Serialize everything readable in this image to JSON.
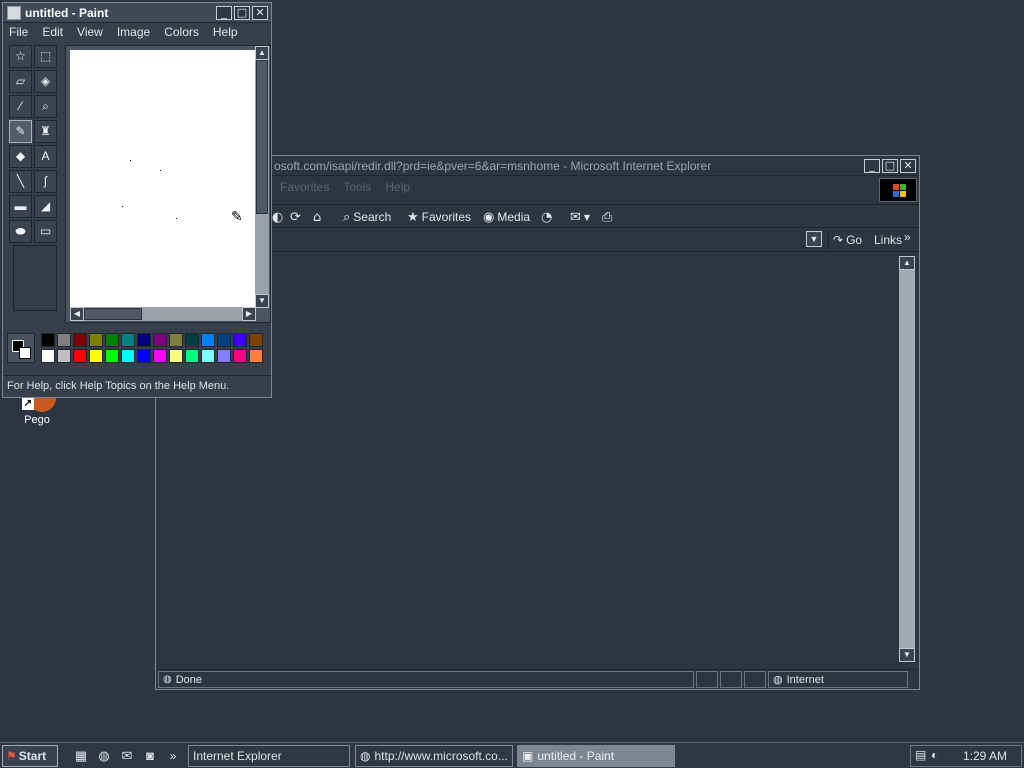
{
  "desktop": {
    "icons": [
      {
        "label": "Pego",
        "icon": "shortcut-icon"
      }
    ]
  },
  "paint": {
    "title": "untitled - Paint",
    "menu": [
      "File",
      "Edit",
      "View",
      "Image",
      "Colors",
      "Help"
    ],
    "tools": [
      "free-select-icon",
      "rect-select-icon",
      "eraser-icon",
      "fill-icon",
      "color-picker-icon",
      "magnifier-icon",
      "pencil-icon",
      "brush-icon",
      "airbrush-icon",
      "text-icon",
      "line-icon",
      "curve-icon",
      "rectangle-icon",
      "polygon-icon",
      "ellipse-icon",
      "rounded-rect-icon"
    ],
    "active_tool": "pencil-icon",
    "text_tool_glyph": "A",
    "status": "For Help, click Help Topics on the Help Menu.",
    "palette": {
      "foreground": "#000000",
      "background": "#ffffff",
      "row1": [
        "#000000",
        "#808080",
        "#800000",
        "#808000",
        "#008000",
        "#008080",
        "#000080",
        "#800080",
        "#808040",
        "#004040",
        "#0080ff",
        "#004080",
        "#4000ff",
        "#804000"
      ],
      "row2": [
        "#ffffff",
        "#c0c0c0",
        "#ff0000",
        "#ffff00",
        "#00ff00",
        "#00ffff",
        "#0000ff",
        "#ff00ff",
        "#ffff80",
        "#00ff80",
        "#80ffff",
        "#8080ff",
        "#ff0080",
        "#ff8040"
      ]
    }
  },
  "ie": {
    "title": "osoft.com/isapi/redir.dll?prd=ie&pver=6&ar=msnhome - Microsoft Internet Explorer",
    "menu": [
      "Favorites",
      "Tools",
      "Help"
    ],
    "toolbar": {
      "search": "Search",
      "favorites": "Favorites",
      "media": "Media"
    },
    "address": {
      "value": "",
      "go": "Go",
      "links": "Links"
    },
    "status": {
      "text": "Done",
      "zone": "Internet"
    }
  },
  "taskbar": {
    "start": "Start",
    "quick_launch_chevron": "»",
    "tasks": [
      {
        "label": "Internet Explorer",
        "active": false
      },
      {
        "label": "http://www.microsoft.co...",
        "active": false
      },
      {
        "label": "untitled - Paint",
        "active": true
      }
    ],
    "clock": "1:29 AM"
  },
  "colors": {
    "desktop": "#2d3540",
    "window": "#373f4b",
    "taskbar": "#2f3742"
  }
}
